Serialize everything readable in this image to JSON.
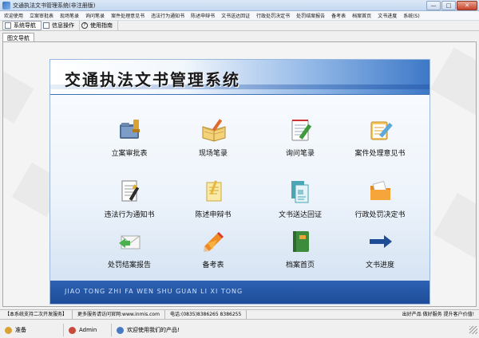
{
  "window": {
    "title": "交通执法文书管理系统(非注册版)",
    "minimize": "—",
    "maximize": "□",
    "close": "✕"
  },
  "menu": [
    "欢迎使用",
    "立案审批表",
    "现场笔录",
    "询问笔录",
    "案件处理意见书",
    "违法行为通知书",
    "陈述申辩书",
    "文书送达回证",
    "行政处罚决定书",
    "处罚结案报告",
    "备考表",
    "档案首页",
    "文书进度",
    "系统(S)"
  ],
  "toolbar": {
    "nav": "系统导航",
    "info": "信息操作",
    "guide": "使用指南"
  },
  "tab": "图文导航",
  "panel": {
    "title": "交通执法文书管理系统",
    "footer_pinyin": "JIAO TONG ZHI FA WEN SHU GUAN LI XI TONG",
    "items": [
      {
        "label": "立案审批表",
        "icon": "folder-stamp-icon"
      },
      {
        "label": "现场笔录",
        "icon": "open-book-pen-icon"
      },
      {
        "label": "询问笔录",
        "icon": "notepad-pencil-icon"
      },
      {
        "label": "案件处理意见书",
        "icon": "clipboard-pencil-icon"
      },
      {
        "label": "违法行为通知书",
        "icon": "document-pen-icon"
      },
      {
        "label": "陈述申辩书",
        "icon": "note-pencil-icon"
      },
      {
        "label": "文书送达回证",
        "icon": "documents-stack-icon"
      },
      {
        "label": "行政处罚决定书",
        "icon": "orange-folder-icon"
      },
      {
        "label": "处罚结案报告",
        "icon": "envelope-arrow-icon"
      },
      {
        "label": "备考表",
        "icon": "colored-pencil-icon"
      },
      {
        "label": "档案首页",
        "icon": "green-book-icon"
      },
      {
        "label": "文书进度",
        "icon": "right-arrow-icon"
      }
    ]
  },
  "status_top": {
    "support": "【本系统支持二次开发服务】",
    "site": "更多服务请访问官网:www.inmis.com",
    "phone": "电话:(0835)8386265 8386255",
    "slogan": "出好产品 做好服务 提升客户价值!"
  },
  "status_bottom": {
    "ready": "准备",
    "user": "Admin",
    "welcome": "欢迎使用我们的产品!"
  }
}
